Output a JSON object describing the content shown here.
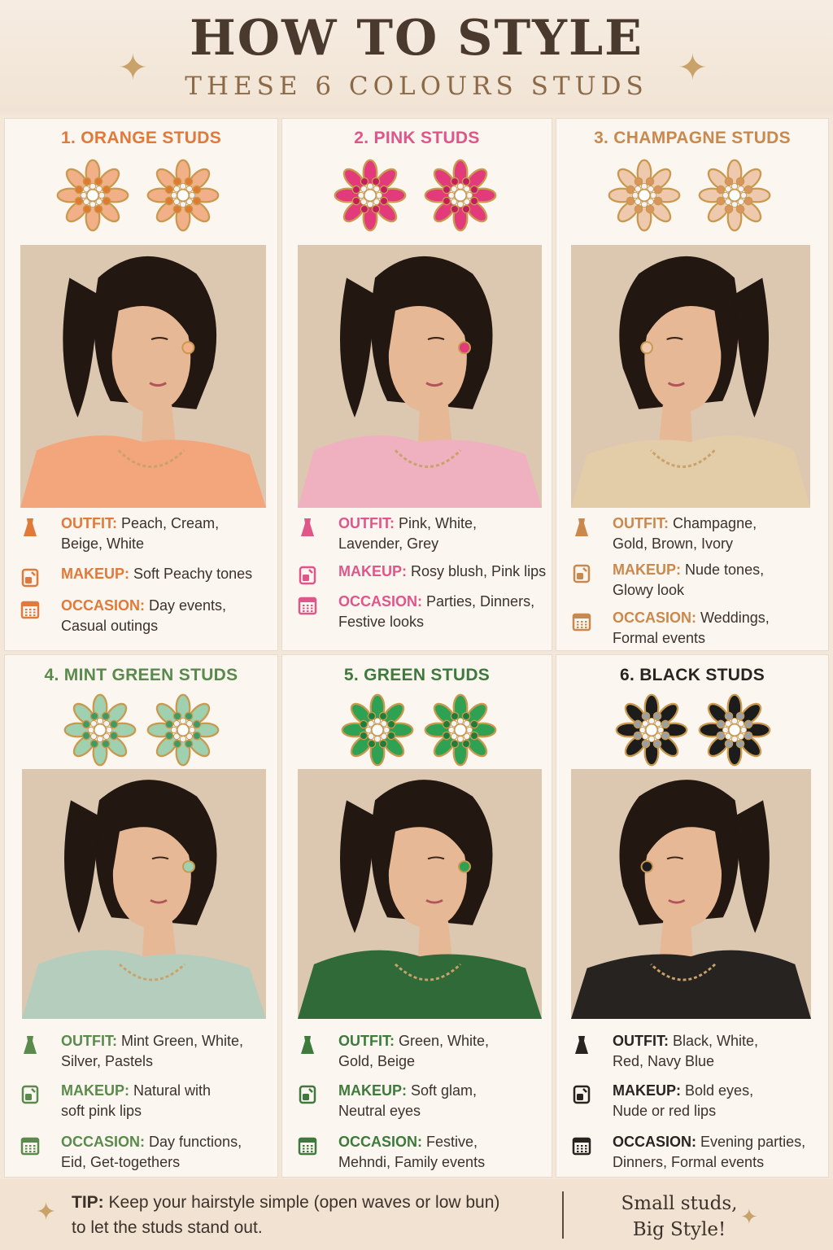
{
  "header": {
    "title": "HOW TO STYLE",
    "subtitle": "THESE 6 COLOURS STUDS"
  },
  "labels": {
    "outfit": "OUTFIT:",
    "makeup": "MAKEUP:",
    "occasion": "OCCASION:"
  },
  "cards": [
    {
      "title": "1. ORANGE STUDS",
      "accent": "#e0793a",
      "gem": "#f2b088",
      "gem_dark": "#e07a2e",
      "dress": "#f3a67c",
      "outfit_line1": "Peach, Cream,",
      "outfit_line2": "Beige, White",
      "makeup_line1": "Soft Peachy tones",
      "makeup_line2": "",
      "occasion_line1": "Day events,",
      "occasion_line2": "Casual outings"
    },
    {
      "title": "2. PINK STUDS",
      "accent": "#e0558a",
      "gem": "#e23a7a",
      "gem_dark": "#c21e5c",
      "dress": "#efb1c0",
      "outfit_line1": "Pink, White,",
      "outfit_line2": "Lavender, Grey",
      "makeup_line1": "Rosy blush, Pink lips",
      "makeup_line2": "",
      "occasion_line1": "Parties, Dinners,",
      "occasion_line2": "Festive looks"
    },
    {
      "title": "3. CHAMPAGNE STUDS",
      "accent": "#c9894e",
      "gem": "#efc9ad",
      "gem_dark": "#d9955e",
      "dress": "#e3cca8",
      "outfit_line1": "Champagne,",
      "outfit_line2": "Gold, Brown, Ivory",
      "makeup_line1": "Nude tones,",
      "makeup_line2": "Glowy look",
      "occasion_line1": "Weddings,",
      "occasion_line2": "Formal events"
    },
    {
      "title": "4. MINT GREEN STUDS",
      "accent": "#5a8a4c",
      "gem": "#9fd1b0",
      "gem_dark": "#3f9b63",
      "dress": "#b5cdbd",
      "outfit_line1": "Mint Green, White,",
      "outfit_line2": "Silver, Pastels",
      "makeup_line1": "Natural with",
      "makeup_line2": "soft pink lips",
      "occasion_line1": "Day functions,",
      "occasion_line2": "Eid, Get-togethers"
    },
    {
      "title": "5. GREEN STUDS",
      "accent": "#3d7a3c",
      "gem": "#2fa152",
      "gem_dark": "#1f7d3b",
      "dress": "#2f6a38",
      "outfit_line1": "Green, White,",
      "outfit_line2": "Gold, Beige",
      "makeup_line1": "Soft glam,",
      "makeup_line2": "Neutral eyes",
      "occasion_line1": "Festive,",
      "occasion_line2": "Mehndi, Family events"
    },
    {
      "title": "6. BLACK STUDS",
      "accent": "#2a2420",
      "gem": "#1c1c1c",
      "gem_dark": "#9aa0a3",
      "dress": "#262321",
      "outfit_line1": "Black, White,",
      "outfit_line2": "Red, Navy Blue",
      "makeup_line1": "Bold eyes,",
      "makeup_line2": "Nude or red lips",
      "occasion_line1": "Evening parties,",
      "occasion_line2": "Dinners, Formal events"
    }
  ],
  "footer": {
    "tip_label": "TIP:",
    "tip_line1": "Keep your hairstyle simple (open waves or low bun)",
    "tip_line2": "to let the studs stand out.",
    "slogan_line1": "Small studs,",
    "slogan_line2": "Big Style!"
  },
  "colors": {
    "background": "#f3e7da",
    "gold": "#c9a26a",
    "skin": "#e7b896",
    "hair": "#221711"
  },
  "icons": [
    "dress-icon",
    "makeup-icon",
    "calendar-icon",
    "sparkle-icon"
  ]
}
